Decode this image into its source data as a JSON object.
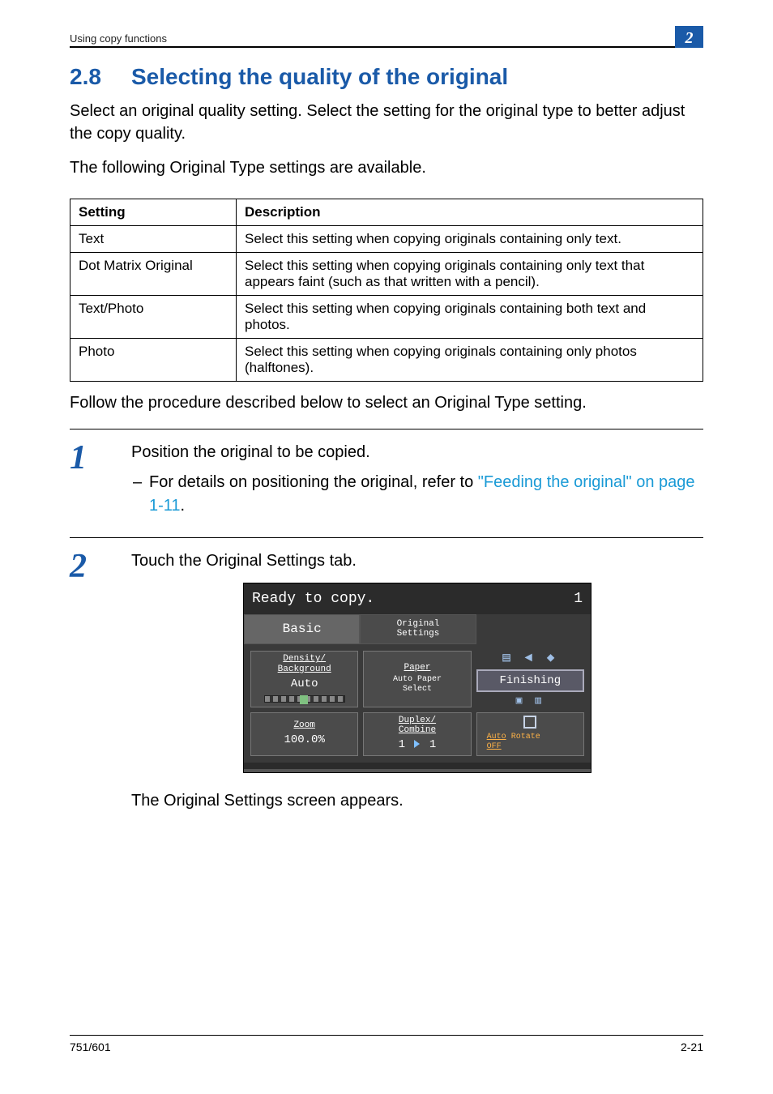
{
  "header": {
    "running_head": "Using copy functions",
    "chapter_badge": "2"
  },
  "section": {
    "number": "2.8",
    "title": "Selecting the quality of the original"
  },
  "intro": {
    "p1": "Select an original quality setting. Select the setting for the original type to better adjust the copy quality.",
    "p2": "The following Original Type settings are available."
  },
  "table": {
    "head": {
      "c1": "Setting",
      "c2": "Description"
    },
    "rows": [
      {
        "c1": "Text",
        "c2": "Select this setting when copying originals containing only text."
      },
      {
        "c1": "Dot Matrix Original",
        "c2": "Select this setting when copying originals containing only text that appears faint (such as that written with a pencil)."
      },
      {
        "c1": "Text/Photo",
        "c2": "Select this setting when copying originals containing both text and photos."
      },
      {
        "c1": "Photo",
        "c2": "Select this setting when copying originals containing only photos (halftones)."
      }
    ]
  },
  "after_table": "Follow the procedure described below to select an Original Type setting.",
  "step1": {
    "num": "1",
    "text": "Position the original to be copied.",
    "sub_pre": "For details on positioning the original, refer to ",
    "sub_link": "\"Feeding the original\" on page 1-11",
    "sub_post": "."
  },
  "step2": {
    "num": "2",
    "text": "Touch the Original Settings tab.",
    "after": "The Original Settings screen appears."
  },
  "panel": {
    "status": "Ready to copy.",
    "count": "1",
    "tabs": {
      "basic": "Basic",
      "original": "Original\nSettings"
    },
    "cells": {
      "density_lab": "Density/\nBackground",
      "density_val": "Auto",
      "paper_lab": "Paper",
      "paper_val": "Auto Paper\nSelect",
      "finishing": "Finishing",
      "zoom_lab": "Zoom",
      "zoom_val": "100.0%",
      "duplex_lab": "Duplex/\nCombine",
      "duplex_left": "1",
      "duplex_right": "1",
      "auto_rotate_l1": "Auto",
      "auto_rotate_l2": "Rotate",
      "auto_rotate_l3": "OFF"
    }
  },
  "footer": {
    "left": "751/601",
    "right": "2-21"
  }
}
